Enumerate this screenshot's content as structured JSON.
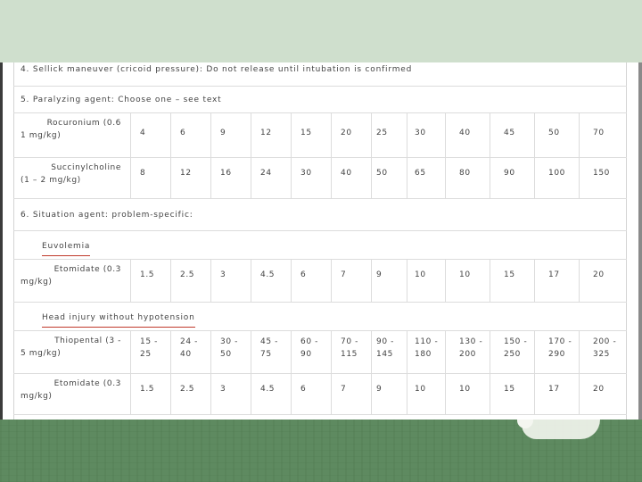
{
  "lines": {
    "sellick": "4. Sellick maneuver (cricoid pressure): Do not release until intubation is confirmed",
    "paralyzing": "5. Paralyzing agent: Choose one – see text",
    "situation": "6. Situation agent: problem-specific:",
    "subhead_1": "Euvolemia",
    "subhead_2": "Head injury without hypotension"
  },
  "rows": [
    {
      "drug_line1": "Rocuronium (0.6",
      "drug_line2": "1 mg/kg)",
      "values": [
        "4",
        "6",
        "9",
        "12",
        "15",
        "20",
        "25",
        "30",
        "40",
        "45",
        "50",
        "70"
      ]
    },
    {
      "drug_line1": "Succinylcholine",
      "drug_line2": "(1 – 2 mg/kg)",
      "values": [
        "8",
        "12",
        "16",
        "24",
        "30",
        "40",
        "50",
        "65",
        "80",
        "90",
        "100",
        "150"
      ]
    },
    {
      "drug_line1": "Etomidate (0.3",
      "drug_line2": "mg/kg)",
      "values": [
        "1.5",
        "2.5",
        "3",
        "4.5",
        "6",
        "7",
        "9",
        "10",
        "10",
        "15",
        "17",
        "20"
      ]
    },
    {
      "drug_line1": "Thiopental (3 -",
      "drug_line2": "5 mg/kg)",
      "values": [
        "15 -\n25",
        "24 -\n40",
        "30 -\n50",
        "45 -\n75",
        "60 -\n90",
        "70 -\n115",
        "90 -\n145",
        "110 -\n180",
        "130 -\n200",
        "150 -\n250",
        "170 -\n290",
        "200 -\n325"
      ]
    },
    {
      "drug_line1": "Etomidate (0.3",
      "drug_line2": "mg/kg)",
      "values": [
        "1.5",
        "2.5",
        "3",
        "4.5",
        "6",
        "7",
        "9",
        "10",
        "10",
        "15",
        "17",
        "20"
      ]
    }
  ]
}
